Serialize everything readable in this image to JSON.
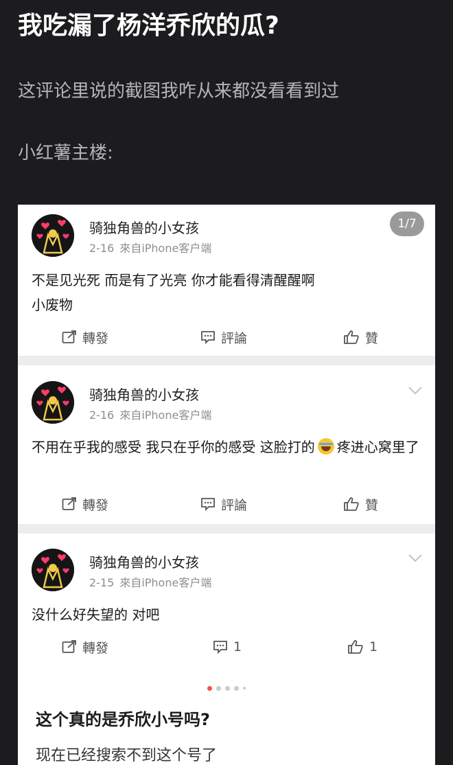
{
  "title": "我吃漏了杨洋乔欣的瓜?",
  "subtext": [
    "这评论里说的截图我咋从来都没看看到过",
    "小红薯主楼:"
  ],
  "screenshot": {
    "page_indicator": "1/7",
    "posts": [
      {
        "username": "骑独角兽的小女孩",
        "date": "2-16",
        "source": "來自iPhone客户端",
        "text_before": "不是见光死 而是有了光亮 你才能看得清醒醒啊 小废物",
        "text_after": "",
        "actions": {
          "repost": "轉發",
          "comment": "評論",
          "like": "贊"
        }
      },
      {
        "username": "骑独角兽的小女孩",
        "date": "2-16",
        "source": "來自iPhone客户端",
        "text_before": "不用在乎我的感受 我只在乎你的感受 这脸打的",
        "text_after": "疼进心窝里了",
        "emoji": "laughing-crying-emoji",
        "actions": {
          "repost": "轉發",
          "comment": "評論",
          "like": "贊"
        }
      },
      {
        "username": "骑独角兽的小女孩",
        "date": "2-15",
        "source": "來自iPhone客户端",
        "text_before": "没什么好失望的 对吧",
        "text_after": "",
        "actions": {
          "repost": "轉發",
          "comment": "1",
          "like": "1"
        }
      }
    ]
  },
  "carousel": {
    "dot_count": 5,
    "active_index": 0
  },
  "post": {
    "title": "这个真的是乔欣小号吗?",
    "body": "现在已经搜索不到这个号了"
  },
  "colors": {
    "background": "#1c1c1e",
    "card": "#ffffff",
    "separator": "#ededed",
    "active_dot": "#ff4d4d"
  },
  "icons": [
    "repost-icon",
    "comment-icon",
    "like-icon",
    "chevron-down-icon",
    "avatar"
  ]
}
